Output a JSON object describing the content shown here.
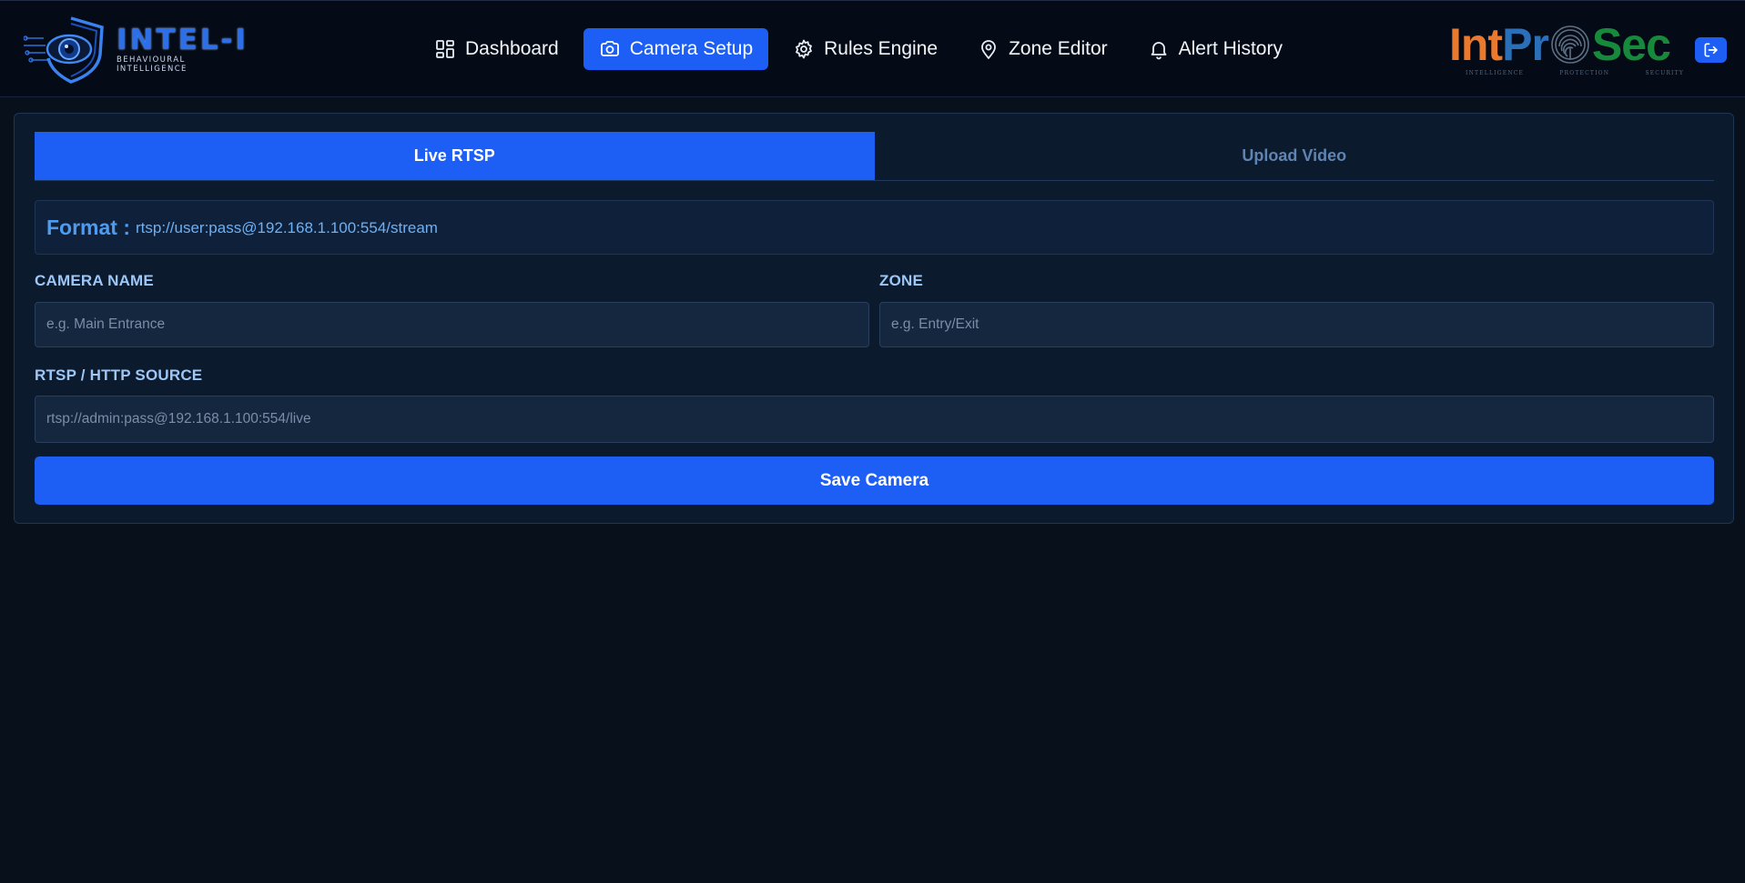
{
  "brand": {
    "name": "INTEL-I",
    "tagline": "BEHAVIOURAL INTELLIGENCE"
  },
  "nav": {
    "items": [
      {
        "label": "Dashboard",
        "icon": "dashboard-grid-icon",
        "active": false
      },
      {
        "label": "Camera Setup",
        "icon": "camera-icon",
        "active": true
      },
      {
        "label": "Rules Engine",
        "icon": "gear-icon",
        "active": false
      },
      {
        "label": "Zone Editor",
        "icon": "map-pin-icon",
        "active": false
      },
      {
        "label": "Alert History",
        "icon": "bell-icon",
        "active": false
      }
    ]
  },
  "partner_logo": {
    "part1": "Int",
    "part2": "Pr",
    "part3": "Sec",
    "tag1": "INTELLIGENCE",
    "tag2": "PROTECTION",
    "tag3": "SECURITY",
    "colors": {
      "int": "#e8792d",
      "pr": "#2a6fb8",
      "sec": "#17893b"
    }
  },
  "logout": {
    "icon": "logout-icon"
  },
  "tabs": [
    {
      "label": "Live RTSP",
      "active": true
    },
    {
      "label": "Upload Video",
      "active": false
    }
  ],
  "format": {
    "label": "Format :",
    "value": "rtsp://user:pass@192.168.1.100:554/stream"
  },
  "form": {
    "camera_name": {
      "label": "CAMERA NAME",
      "placeholder": "e.g. Main Entrance",
      "value": ""
    },
    "zone": {
      "label": "ZONE",
      "placeholder": "e.g. Entry/Exit",
      "value": ""
    },
    "source": {
      "label": "RTSP / HTTP SOURCE",
      "placeholder": "rtsp://admin:pass@192.168.1.100:554/live",
      "value": ""
    },
    "save_label": "Save Camera"
  },
  "colors": {
    "accent": "#1d5ff5",
    "background": "#08101c",
    "panel": "#0c1a2e"
  }
}
